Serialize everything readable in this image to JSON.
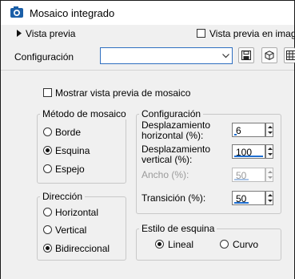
{
  "window": {
    "title": "Mosaico integrado"
  },
  "top": {
    "preview_toggle_label": "Vista previa",
    "preview_checkbox_label": "Vista previa en imagen",
    "config_label": "Configuración",
    "config_select_value": ""
  },
  "options": {
    "show_mosaic_preview_label": "Mostrar vista previa de mosaico"
  },
  "method": {
    "legend": "Método de mosaico",
    "items": [
      "Borde",
      "Esquina",
      "Espejo"
    ],
    "selected": "Esquina"
  },
  "settings": {
    "legend": "Configuración",
    "h_offset_label": "Desplazamiento horizontal (%):",
    "h_offset_value": "6",
    "v_offset_label": "Desplazamiento vertical (%):",
    "v_offset_value": "100",
    "width_label": "Ancho (%):",
    "width_value": "50",
    "transition_label": "Transición (%):",
    "transition_value": "50"
  },
  "direction": {
    "legend": "Dirección",
    "items": [
      "Horizontal",
      "Vertical",
      "Bidireccional"
    ],
    "selected": "Bidireccional"
  },
  "corner": {
    "legend": "Estilo de esquina",
    "items": [
      "Lineal",
      "Curvo"
    ],
    "selected": "Lineal"
  },
  "icons": {
    "app": "camera-icon",
    "preview_toggle": "triangle-right-icon",
    "dropdown": "chevron-down-icon",
    "save": "save-icon",
    "preset": "cube-icon",
    "reset": "grid-icon"
  },
  "colors": {
    "accent": "#1f6fd1"
  }
}
